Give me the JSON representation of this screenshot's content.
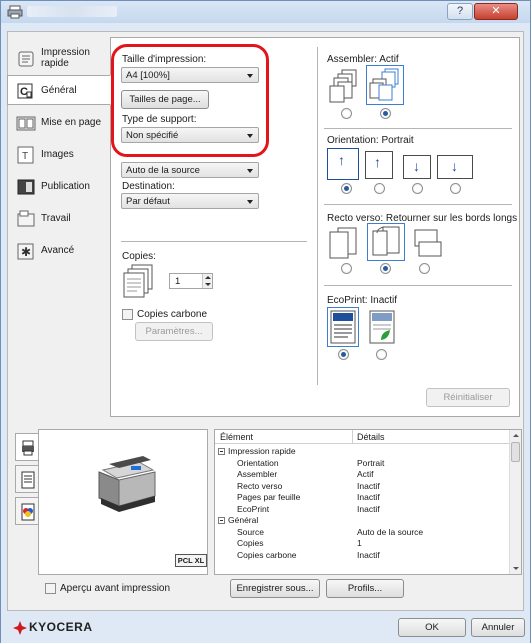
{
  "nav": {
    "items": [
      {
        "label": "Impression rapide",
        "icon": "quick-print-icon"
      },
      {
        "label": "Général",
        "icon": "general-icon"
      },
      {
        "label": "Mise en page",
        "icon": "layout-icon"
      },
      {
        "label": "Images",
        "icon": "images-icon"
      },
      {
        "label": "Publication",
        "icon": "publishing-icon"
      },
      {
        "label": "Travail",
        "icon": "job-icon"
      },
      {
        "label": "Avancé",
        "icon": "advanced-icon"
      }
    ],
    "active_index": 1
  },
  "general": {
    "print_size_label": "Taille d'impression:",
    "print_size_value": "A4 [100%]",
    "page_sizes_button": "Tailles de page...",
    "media_type_label": "Type de support:",
    "media_type_value": "Non spécifié",
    "source_value": "Auto de la source",
    "destination_label": "Destination:",
    "destination_value": "Par défaut",
    "copies_label": "Copies:",
    "copies_value": "1",
    "carbon_copies_label": "Copies carbone",
    "carbon_copies_checked": false,
    "parameters_button": "Paramètres...",
    "collate_label": "Assembler: Actif",
    "collate_selected": 1,
    "orientation_label": "Orientation: Portrait",
    "orientation_selected": 0,
    "duplex_label": "Recto verso: Retourner sur les bords longs",
    "duplex_selected": 1,
    "ecoprint_label": "EcoPrint: Inactif",
    "ecoprint_selected": 0,
    "reset_button": "Réinitialiser"
  },
  "preview": {
    "pdl_badge": "PCL XL",
    "preview_checkbox_label": "Aperçu avant impression",
    "preview_checked": false,
    "save_as_button": "Enregistrer sous...",
    "profiles_button": "Profils..."
  },
  "summary": {
    "col_item": "Élément",
    "col_details": "Détails",
    "rows": [
      {
        "key": "Impression rapide",
        "value": "",
        "group": true
      },
      {
        "key": "Orientation",
        "value": "Portrait",
        "group": false
      },
      {
        "key": "Assembler",
        "value": "Actif",
        "group": false
      },
      {
        "key": "Recto verso",
        "value": "Inactif",
        "group": false
      },
      {
        "key": "Pages par feuille",
        "value": "Inactif",
        "group": false
      },
      {
        "key": "EcoPrint",
        "value": "Inactif",
        "group": false
      },
      {
        "key": "Général",
        "value": "",
        "group": true
      },
      {
        "key": "Source",
        "value": "Auto de la source",
        "group": false
      },
      {
        "key": "Copies",
        "value": "1",
        "group": false
      },
      {
        "key": "Copies carbone",
        "value": "Inactif",
        "group": false
      }
    ]
  },
  "footer": {
    "brand": "KYOCERA",
    "ok_button": "OK",
    "cancel_button": "Annuler"
  },
  "colors": {
    "highlight_box": "#e3151a",
    "brand_red": "#d0191e",
    "selection_blue": "#3c7fd1"
  }
}
